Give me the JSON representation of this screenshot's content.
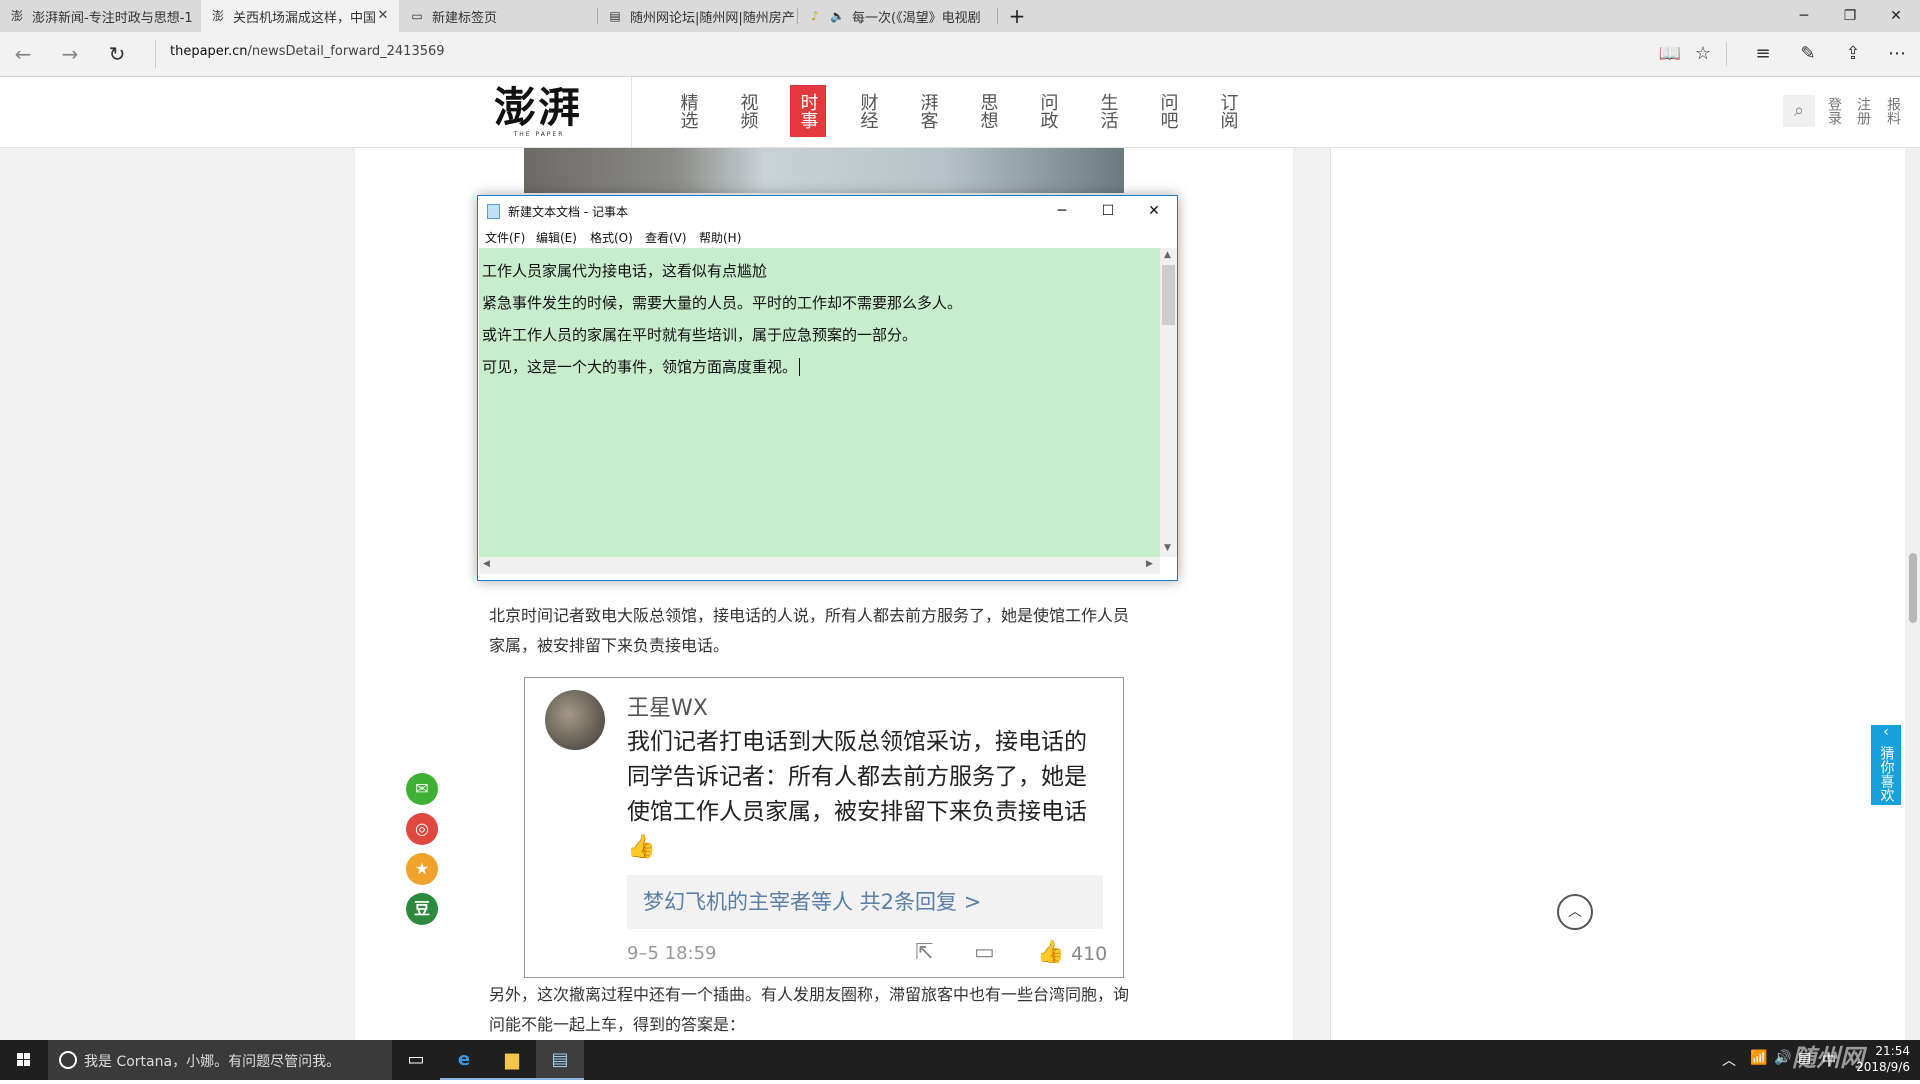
{
  "browser": {
    "tabs": [
      {
        "title": "澎湃新闻-专注时政与思想-1",
        "icon": "thepaper-favicon",
        "active": false
      },
      {
        "title": "关西机场漏成这样，中国",
        "icon": "thepaper-favicon",
        "active": true
      },
      {
        "title": "新建标签页",
        "icon": "new-tab-page-icon",
        "active": false
      },
      {
        "title": "随州网论坛|随州网|随州房产",
        "icon": "page-icon",
        "active": false
      },
      {
        "title": "每一次(《渴望》电视剧",
        "icon": "music-favicon",
        "active": false,
        "audio": true
      }
    ],
    "url_domain": "thepaper.cn",
    "url_path": "/newsDetail_forward_2413569"
  },
  "site": {
    "logo_cn": "澎湃",
    "logo_en": "THE PAPER",
    "nav": [
      "精选",
      "视频",
      "时事",
      "财经",
      "湃客",
      "思想",
      "问政",
      "生活",
      "问吧",
      "订阅"
    ],
    "active_nav": "时事",
    "header_links": [
      "登录",
      "注册",
      "报料"
    ]
  },
  "notepad": {
    "title": "新建文本文档 - 记事本",
    "menu": [
      "文件(F)",
      "编辑(E)",
      "格式(O)",
      "查看(V)",
      "帮助(H)"
    ],
    "lines": [
      "工作人员家属代为接电话，这看似有点尴尬",
      "紧急事件发生的时候，需要大量的人员。平时的工作却不需要那么多人。",
      "或许工作人员的家属在平时就有些培训，属于应急预案的一部分。",
      "可见，这是一个大的事件，领馆方面高度重视。"
    ],
    "bg_color": "#c7edcc"
  },
  "article": {
    "para1_a": "北京时间记者致电大阪总领馆，接电话的人说，所有人都去前方服务了，她是使馆工作人员",
    "para1_b": "家属，被安排留下来负责接电话。",
    "para2_a": "另外，这次撤离过程中还有一个插曲。有人发朋友圈称，滞留旅客中也有一些台湾同胞，询",
    "para2_b": "问能不能一起上车，得到的答案是：",
    "card": {
      "username": "王星WX",
      "text": "我们记者打电话到大阪总领馆采访，接电话的同学告诉记者：所有人都去前方服务了，她是使馆工作人员家属，被安排留下来负责接电话👍",
      "reply": "梦幻飞机的主宰者等人  共2条回复 >",
      "time": "9–5 18:59",
      "likes": "410"
    },
    "share": [
      "wechat-icon",
      "weibo-icon",
      "star-icon",
      "douban-icon"
    ],
    "douban_label": "豆",
    "guess_label": "猜你喜欢"
  },
  "taskbar": {
    "cortana_text": "我是 Cortana，小娜。有问题尽管问我。",
    "ime": "中",
    "time": "21:54",
    "date": "2018/9/6"
  },
  "watermark": "随州网",
  "colors": {
    "accent_red": "#e4393c",
    "notepad_green": "#c7edcc",
    "guess_blue": "#17a0da",
    "reply_link": "#5b7fa6"
  }
}
